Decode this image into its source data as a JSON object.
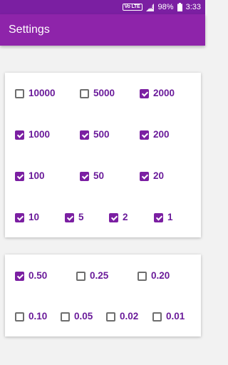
{
  "status": {
    "network_badge": "Vo LTE",
    "battery": "98%",
    "time": "3:33",
    "icons": [
      "volte-icon",
      "signal-icon",
      "battery-icon"
    ]
  },
  "app_bar": {
    "title": "Settings"
  },
  "colors": {
    "primary": "#8e24aa",
    "primary_dark": "#7b1fa2",
    "label": "#6a1b9a"
  },
  "card1": {
    "items": [
      {
        "label": "10000",
        "checked": false
      },
      {
        "label": "5000",
        "checked": false
      },
      {
        "label": "2000",
        "checked": true
      },
      {
        "label": "1000",
        "checked": true
      },
      {
        "label": "500",
        "checked": true
      },
      {
        "label": "200",
        "checked": true
      },
      {
        "label": "100",
        "checked": true
      },
      {
        "label": "50",
        "checked": true
      },
      {
        "label": "20",
        "checked": true
      },
      {
        "label": "10",
        "checked": true
      },
      {
        "label": "5",
        "checked": true
      },
      {
        "label": "2",
        "checked": true
      },
      {
        "label": "1",
        "checked": true
      }
    ]
  },
  "card2": {
    "items": [
      {
        "label": "0.50",
        "checked": true
      },
      {
        "label": "0.25",
        "checked": false
      },
      {
        "label": "0.20",
        "checked": false
      },
      {
        "label": "0.10",
        "checked": false
      },
      {
        "label": "0.05",
        "checked": false
      },
      {
        "label": "0.02",
        "checked": false
      },
      {
        "label": "0.01",
        "checked": false
      }
    ]
  }
}
